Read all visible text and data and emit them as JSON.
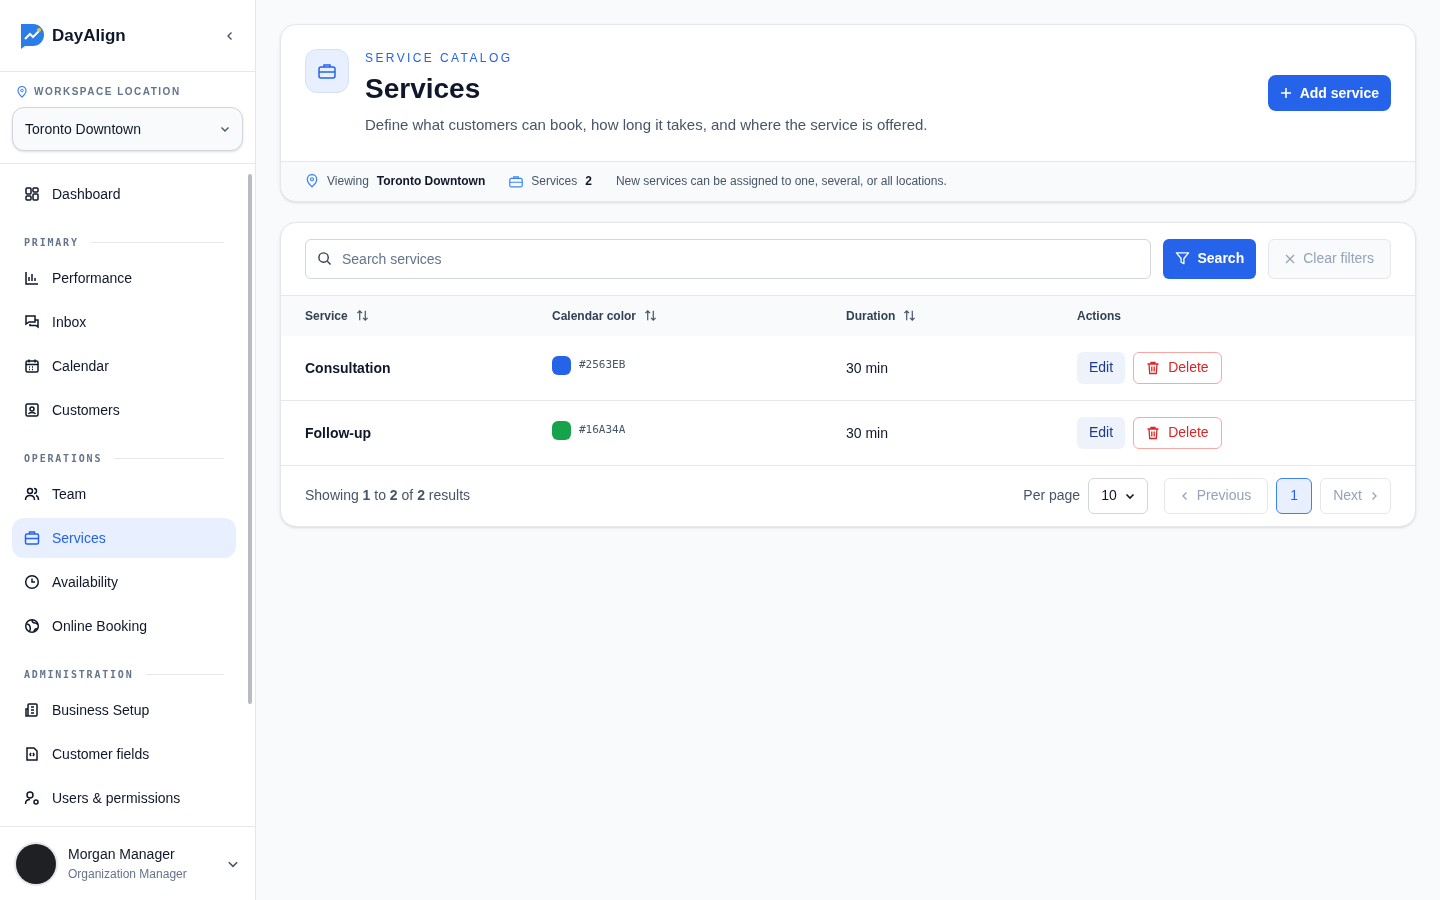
{
  "brand": {
    "name": "DayAlign"
  },
  "workspace": {
    "label": "WORKSPACE LOCATION",
    "value": "Toronto Downtown"
  },
  "nav": [
    {
      "kind": "item",
      "label": "Dashboard",
      "selected": false
    },
    {
      "kind": "section",
      "label": "PRIMARY"
    },
    {
      "kind": "item",
      "label": "Performance",
      "selected": false
    },
    {
      "kind": "item",
      "label": "Inbox",
      "selected": false
    },
    {
      "kind": "item",
      "label": "Calendar",
      "selected": false
    },
    {
      "kind": "item",
      "label": "Customers",
      "selected": false
    },
    {
      "kind": "section",
      "label": "OPERATIONS"
    },
    {
      "kind": "item",
      "label": "Team",
      "selected": false
    },
    {
      "kind": "item",
      "label": "Services",
      "selected": true
    },
    {
      "kind": "item",
      "label": "Availability",
      "selected": false
    },
    {
      "kind": "item",
      "label": "Online Booking",
      "selected": false
    },
    {
      "kind": "section",
      "label": "ADMINISTRATION"
    },
    {
      "kind": "item",
      "label": "Business Setup",
      "selected": false
    },
    {
      "kind": "item",
      "label": "Customer fields",
      "selected": false
    },
    {
      "kind": "item",
      "label": "Users & permissions",
      "selected": false
    }
  ],
  "user": {
    "name": "Morgan Manager",
    "role": "Organization Manager"
  },
  "header": {
    "eyebrow": "SERVICE CATALOG",
    "title": "Services",
    "description": "Define what customers can book, how long it takes, and where the service is offered.",
    "add_button": "Add service"
  },
  "info_bar": {
    "viewing_label": "Viewing",
    "viewing_value": "Toronto Downtown",
    "services_label": "Services",
    "services_count": "2",
    "note": "New services can be assigned to one, several, or all locations."
  },
  "filters": {
    "search_placeholder": "Search services",
    "search_button": "Search",
    "clear_button": "Clear filters"
  },
  "table": {
    "columns": [
      {
        "label": "Service",
        "sortable": true
      },
      {
        "label": "Calendar color",
        "sortable": true
      },
      {
        "label": "Duration",
        "sortable": true
      },
      {
        "label": "Actions",
        "sortable": false
      }
    ],
    "rows": [
      {
        "service": "Consultation",
        "color": "#2563eb",
        "color_label": "#2563EB",
        "duration": "30 min",
        "edit": "Edit",
        "delete": "Delete"
      },
      {
        "service": "Follow-up",
        "color": "#16a34a",
        "color_label": "#16A34A",
        "duration": "30 min",
        "edit": "Edit",
        "delete": "Delete"
      }
    ]
  },
  "pagination": {
    "summary": "Showing **1** to **2** of **2** results",
    "per_page_label": "Per page",
    "per_page": "10",
    "previous": "Previous",
    "pages": [
      {
        "label": "1",
        "selected": true
      }
    ],
    "next": "Next"
  }
}
